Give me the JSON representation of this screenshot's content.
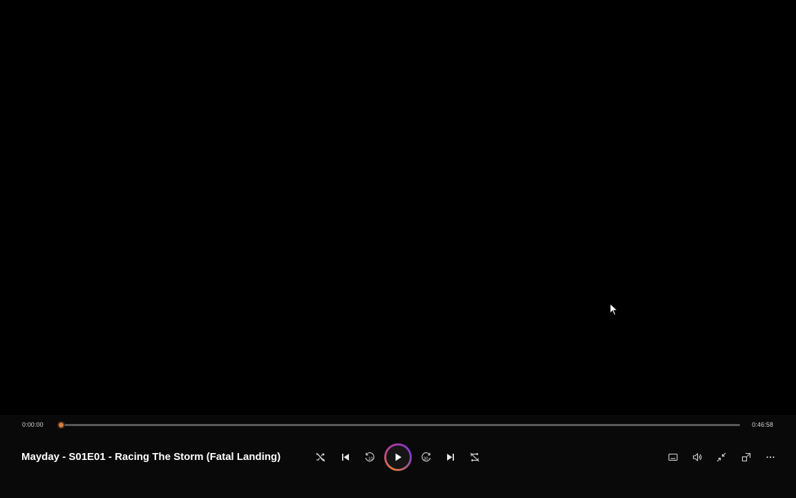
{
  "player": {
    "title": "Mayday - S01E01 - Racing The Storm (Fatal Landing)",
    "current_time": "0:00:00",
    "total_time": "0:46:58",
    "progress": 0.0
  },
  "controls": {
    "left": [
      {
        "name": "shuffle-button",
        "icon": "shuffle-off-icon"
      },
      {
        "name": "previous-button",
        "icon": "skip-previous-icon"
      },
      {
        "name": "rewind-10-button",
        "icon": "rewind-10-icon",
        "label": "10"
      },
      {
        "name": "play-button",
        "icon": "play-icon"
      },
      {
        "name": "forward-30-button",
        "icon": "forward-30-icon",
        "label": "30"
      },
      {
        "name": "next-button",
        "icon": "skip-next-icon"
      },
      {
        "name": "repeat-button",
        "icon": "repeat-off-icon"
      }
    ],
    "right": [
      {
        "name": "captions-button",
        "icon": "captions-icon"
      },
      {
        "name": "volume-button",
        "icon": "volume-icon"
      },
      {
        "name": "exit-fullscreen-button",
        "icon": "exit-fullscreen-icon"
      },
      {
        "name": "mini-player-button",
        "icon": "mini-player-icon"
      },
      {
        "name": "more-options-button",
        "icon": "more-icon"
      }
    ]
  },
  "colors": {
    "accent": "#e07b39",
    "accent_gradient_end": "#7a3bd0",
    "bar_background": "#090909",
    "track": "#5a5a5a"
  }
}
